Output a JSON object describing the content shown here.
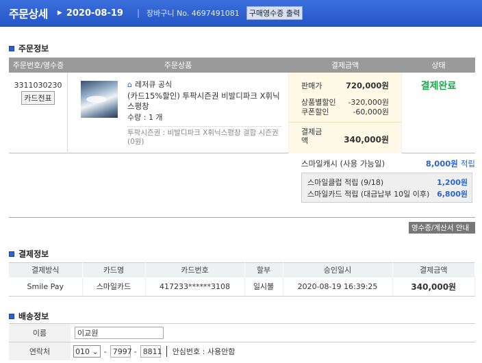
{
  "header": {
    "title": "주문상세",
    "arrow": "▶",
    "date": "2020-08-19",
    "separator": "|",
    "cart_label": "장바구니 No. 4697491081",
    "receipt_button": "구매영수증 출력"
  },
  "order_section": {
    "title": "주문정보",
    "columns": [
      "주문번호/영수증",
      "주문상품",
      "결제금액",
      "상태"
    ],
    "order_no": "3311030230",
    "card_slip_button": "카드전표",
    "shop_name": "레저큐 공식",
    "product_name": "(카드15%할인) 투팍시즌권 비발디파크 X휘닉스평창",
    "quantity": "수량 : 1 개",
    "option": "투팍시즌권 : 비발디파크 X휘닉스평창 결합 시즌권 (0원)",
    "sale_label": "판매가",
    "sale_value": "720,000원",
    "discount_label": "상품별할인",
    "discount_value": "-320,000원",
    "coupon_label": "쿠폰할인",
    "coupon_value": "-60,000원",
    "total_label": "결제금액",
    "total_value": "340,000원",
    "status": "결제완료"
  },
  "smile_cash": {
    "label": "스마일캐시 (사용 가능일)",
    "value": "8,000원",
    "suffix": "적립",
    "club_label": "스마일클럽 적립 (9/18)",
    "club_value": "1,200원",
    "card_label": "스마일카드 적립 (대금납부 10일 이후)",
    "card_value": "6,800원"
  },
  "receipt_tax_button": "영수증/계산서 안내",
  "payment_section": {
    "title": "결제정보",
    "columns": [
      "결제방식",
      "카드명",
      "카드번호",
      "할부",
      "승인일시",
      "결제금액"
    ],
    "row": [
      "Smile Pay",
      "스마일카드",
      "417233******3108",
      "일시불",
      "2020-08-19 16:39:25",
      "340,000원"
    ]
  },
  "delivery_section": {
    "title": "배송정보",
    "name_label": "이름",
    "name_value": "이교원",
    "phone_label": "연락처",
    "phone_prefix": "010",
    "phone_mid": "7997",
    "phone_last": "8811",
    "safe_number": "안심번호 : 사용안함"
  },
  "icons": {
    "home": "home-icon",
    "section_marker": "square-icon"
  },
  "colors": {
    "header_bg": "#2f62d0",
    "status": "#1aa84a",
    "link_blue": "#2a63d4"
  }
}
